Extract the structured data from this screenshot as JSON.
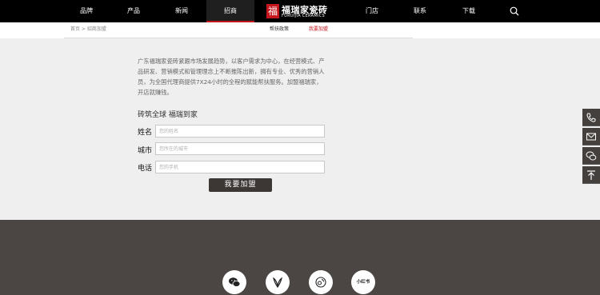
{
  "nav": {
    "items": [
      {
        "label": "品牌"
      },
      {
        "label": "产品"
      },
      {
        "label": "新闻"
      },
      {
        "label": "招商"
      },
      {
        "label": "门店"
      },
      {
        "label": "联系"
      },
      {
        "label": "下载"
      }
    ],
    "logo_mark": "福",
    "logo_cn": "福瑞家瓷砖",
    "logo_en": "FURUIJIA CERAMICS",
    "active_color": "#c4161c"
  },
  "subbar": {
    "breadcrumb": "首页 > 招商加盟",
    "tabs": [
      {
        "label": "帮扶政策"
      },
      {
        "label": "我要加盟"
      }
    ]
  },
  "intro": {
    "text": "广东福瑞家瓷砖紧跟市场发展趋势，以客户需求为中心，在经营模式、产品研发、营销模式和管理理念上不断推陈出新，拥有专业、优秀的营销人员，为全国代理商提供7X24小时的全程的赋能帮扶服务。加盟福瑞家，开店就赚钱。"
  },
  "form": {
    "slogan": "砖筑全球 福瑞到家",
    "fields": [
      {
        "label": "姓名",
        "placeholder": "您的姓名",
        "value": ""
      },
      {
        "label": "城市",
        "placeholder": "您所在的城市",
        "value": ""
      },
      {
        "label": "电话",
        "placeholder": "您的手机",
        "value": ""
      }
    ],
    "submit_label": "我要加盟"
  },
  "float_buttons": [
    {
      "icon": "phone-icon"
    },
    {
      "icon": "mail-icon"
    },
    {
      "icon": "wechat-icon"
    },
    {
      "icon": "back-to-top-icon"
    }
  ],
  "footer": {
    "socials": [
      {
        "icon": "wechat-icon"
      },
      {
        "icon": "douyin-icon"
      },
      {
        "icon": "weibo-icon"
      },
      {
        "icon": "xiaohongshu-icon",
        "label": "小红书"
      }
    ]
  }
}
